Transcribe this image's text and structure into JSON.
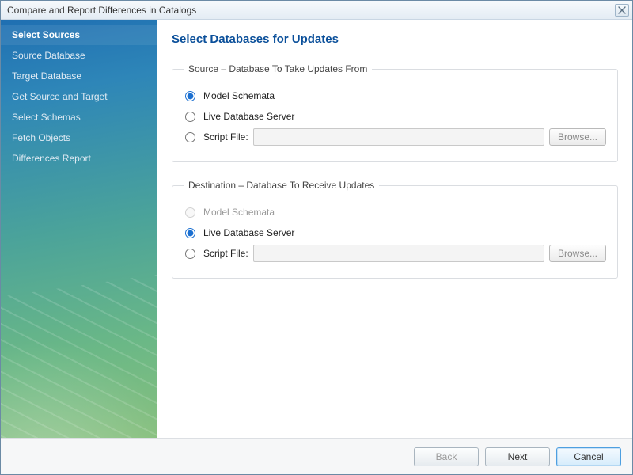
{
  "window": {
    "title": "Compare and Report Differences in Catalogs"
  },
  "sidebar": {
    "items": [
      {
        "label": "Select Sources",
        "active": true
      },
      {
        "label": "Source Database"
      },
      {
        "label": "Target Database"
      },
      {
        "label": "Get Source and Target"
      },
      {
        "label": "Select Schemas"
      },
      {
        "label": "Fetch Objects"
      },
      {
        "label": "Differences Report"
      }
    ]
  },
  "main": {
    "title": "Select Databases for Updates",
    "source": {
      "legend": "Source – Database To Take Updates From",
      "options": {
        "model": "Model Schemata",
        "live": "Live Database Server",
        "script": "Script File:"
      },
      "selected": "model",
      "browse": "Browse..."
    },
    "destination": {
      "legend": "Destination – Database To Receive Updates",
      "options": {
        "model": "Model Schemata",
        "live": "Live Database Server",
        "script": "Script File:"
      },
      "selected": "live",
      "model_disabled": true,
      "browse": "Browse..."
    }
  },
  "footer": {
    "back": "Back",
    "next": "Next",
    "cancel": "Cancel"
  }
}
